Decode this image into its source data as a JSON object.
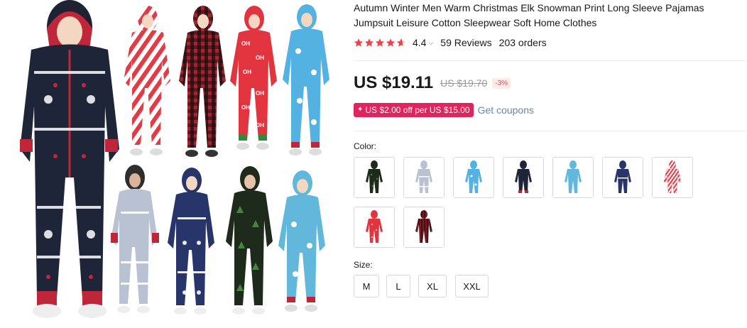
{
  "product": {
    "title": "Autumn Winter Men Warm Christmas Elk Snowman Print Long Sleeve Pajamas Jumpsuit Leisure Cotton Sleepwear Soft Home Clothes",
    "image_alt": "Product photo collage of Christmas onesie pajamas"
  },
  "rating": {
    "value": "4.4",
    "stars": 4.4,
    "reviews": "59 Reviews",
    "orders": "203 orders"
  },
  "price": {
    "current": "US $19.11",
    "original": "US $19.70",
    "discount": "-3%"
  },
  "coupon": {
    "badge_text": "US $2.00 off per US $15.00",
    "link_text": "Get coupons"
  },
  "color": {
    "label": "Color:",
    "options": [
      {
        "name": "black green tree print",
        "primary": "#1e2a1c",
        "accent": "#3f8a3a"
      },
      {
        "name": "light grey snowflake",
        "primary": "#b9c2d3",
        "accent": "#e8ecf3"
      },
      {
        "name": "sky blue snowman",
        "primary": "#53b2e2",
        "accent": "#ffffff"
      },
      {
        "name": "navy elk red trim",
        "primary": "#1f2538",
        "accent": "#c0263a"
      },
      {
        "name": "light blue",
        "primary": "#62b8db",
        "accent": "#ffffff"
      },
      {
        "name": "navy snowflake",
        "primary": "#27356a",
        "accent": "#ffffff"
      },
      {
        "name": "candy cane stripes",
        "primary": "#ffffff",
        "accent": "#e13b45"
      },
      {
        "name": "red OH print",
        "primary": "#e2343e",
        "accent": "#ffffff"
      },
      {
        "name": "red plaid",
        "primary": "#7a1b24",
        "accent": "#2a0c10"
      }
    ]
  },
  "size": {
    "label": "Size:",
    "options": [
      "M",
      "L",
      "XL",
      "XXL"
    ]
  },
  "colors": {
    "star": "#e64545",
    "price_text": "#191919",
    "coupon_bg": "#e0245e",
    "link": "#6b86ab"
  },
  "icons": {
    "star": "star-icon",
    "coupon": "lightning-icon",
    "caret": "chevron-down-icon"
  }
}
